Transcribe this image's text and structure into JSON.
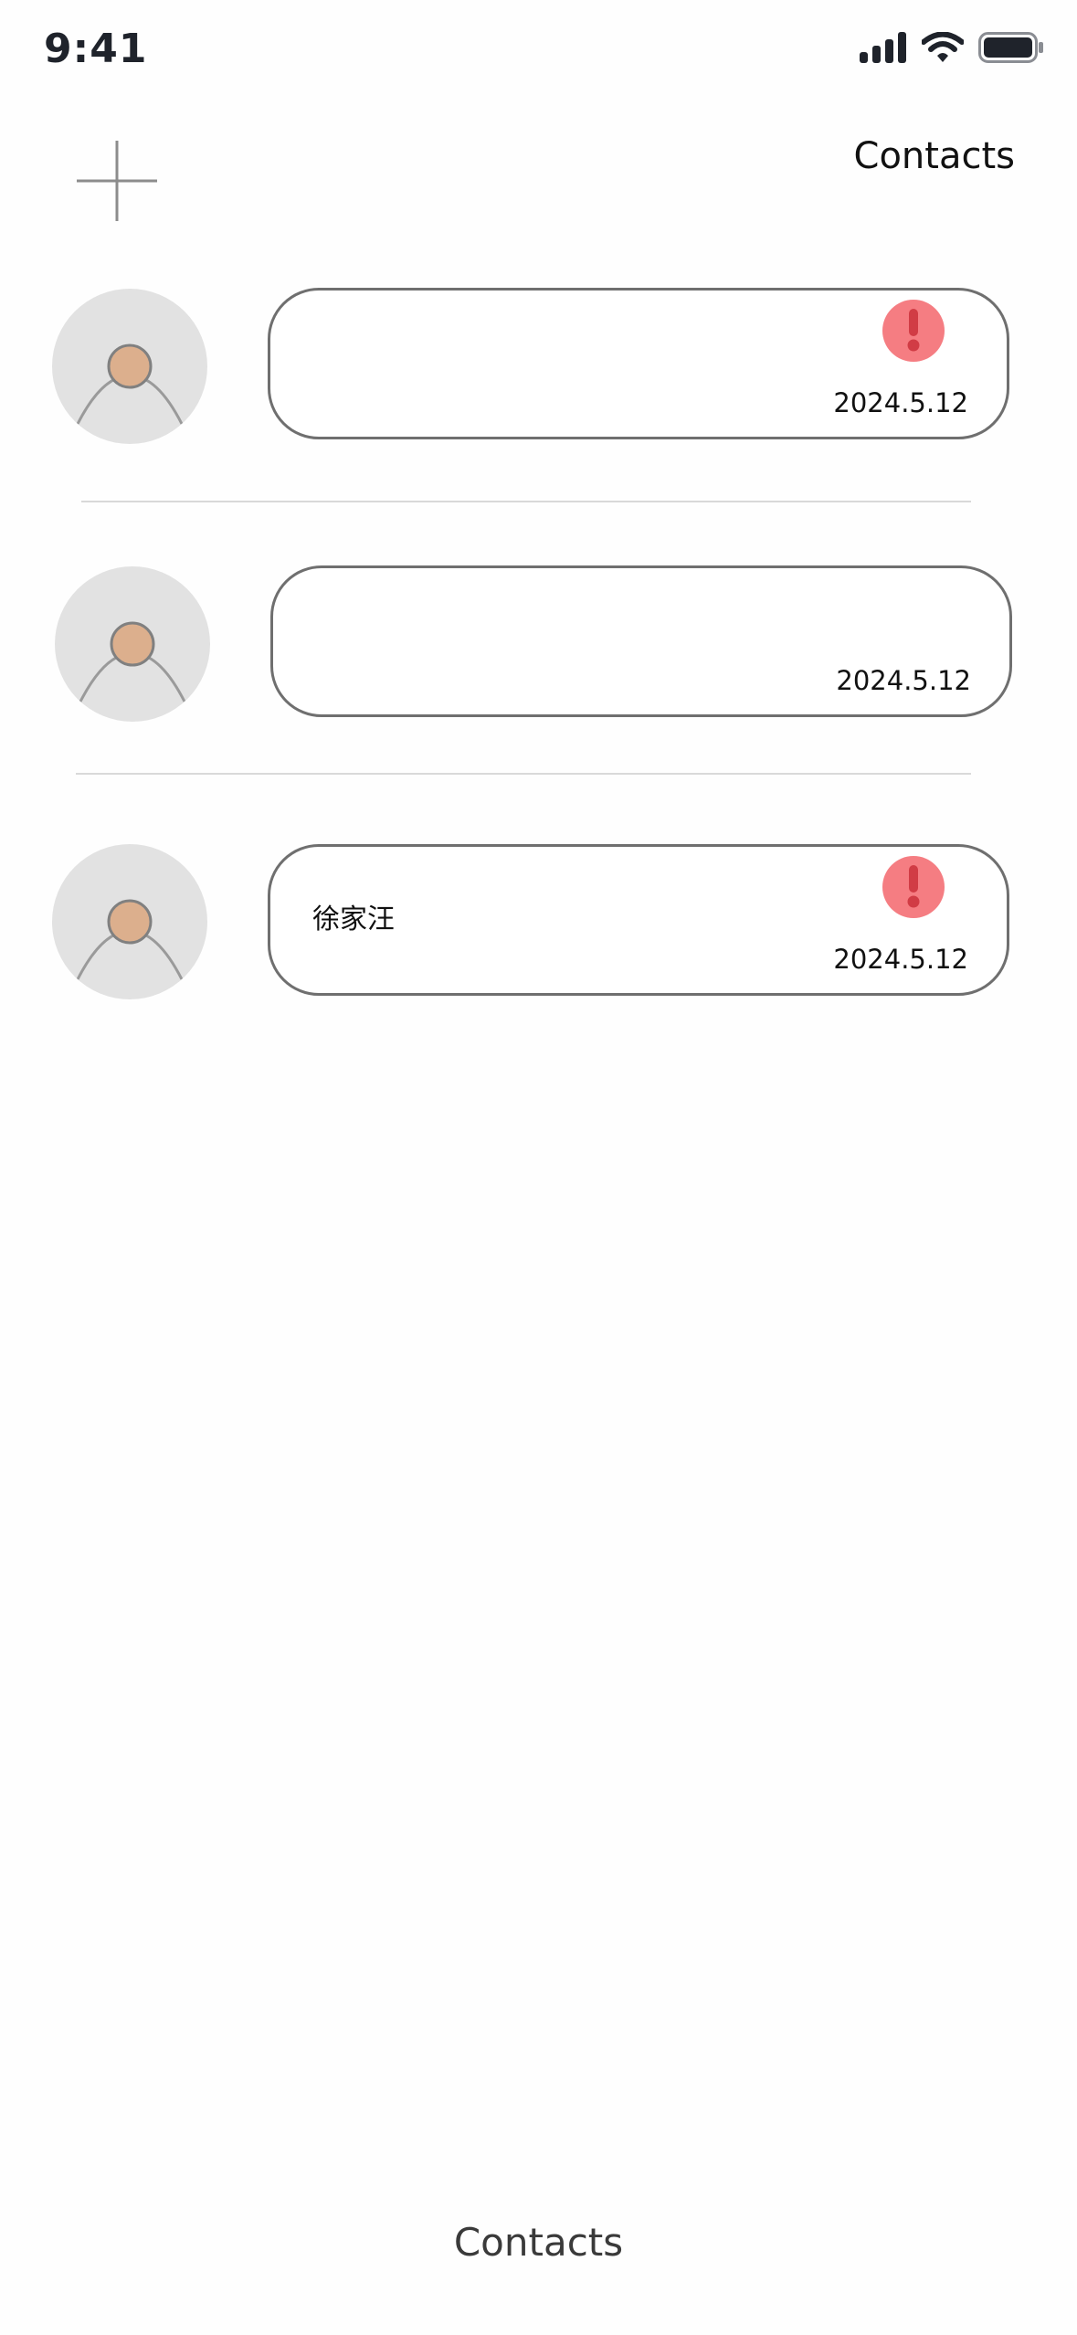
{
  "status_bar": {
    "time": "9:41",
    "icons": [
      "cellular-signal-icon",
      "wifi-icon",
      "battery-icon"
    ]
  },
  "header": {
    "add_icon": "plus-icon",
    "title": "Contacts"
  },
  "contacts": [
    {
      "name": "",
      "date": "2024.5.12",
      "alert": true
    },
    {
      "name": "",
      "date": "2024.5.12",
      "alert": false
    },
    {
      "name": "徐家汪",
      "date": "2024.5.12",
      "alert": true
    }
  ],
  "bottom_nav": {
    "label": "Contacts"
  },
  "colors": {
    "alert_bg": "#f57d82",
    "alert_mark": "#d13c45",
    "avatar_bg": "#e2e2e2",
    "avatar_head": "#dcaf8d",
    "card_border": "#6f6f6f"
  }
}
